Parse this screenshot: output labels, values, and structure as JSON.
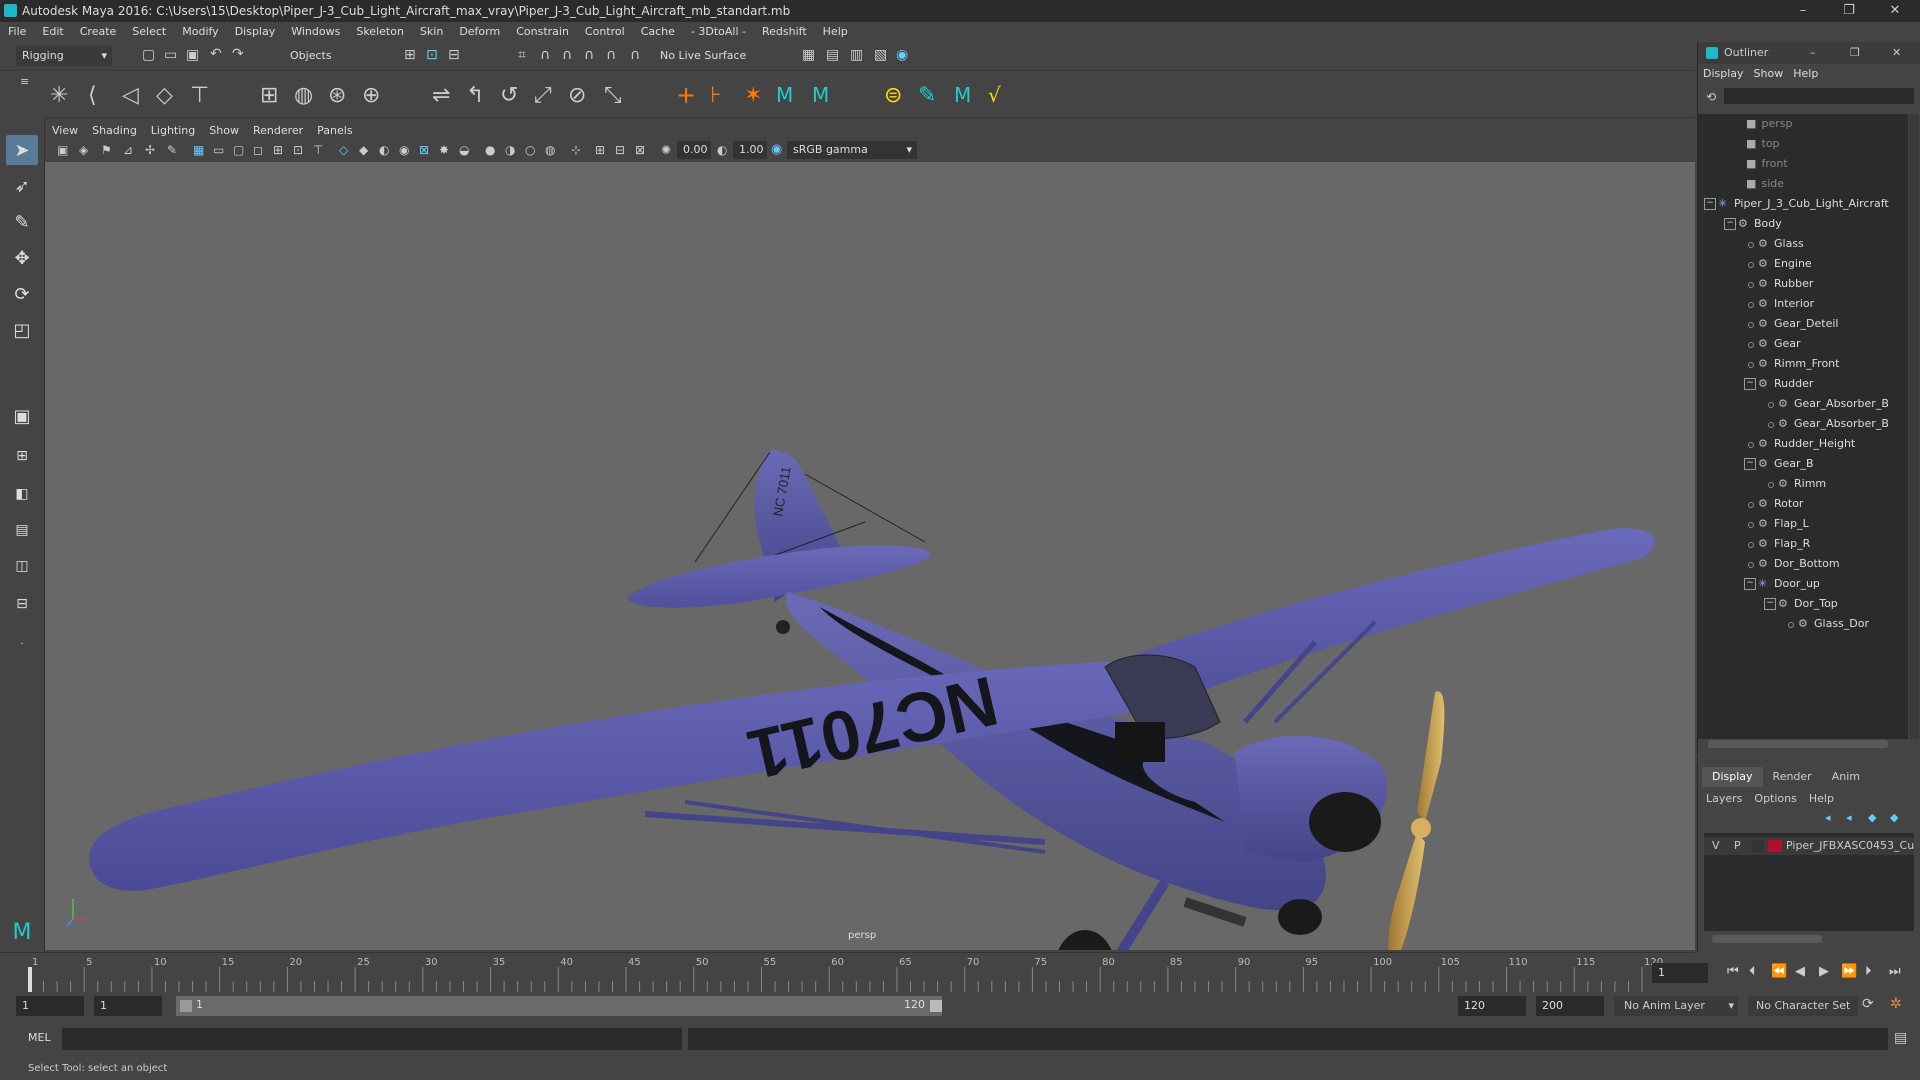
{
  "window": {
    "title": "Autodesk Maya 2016: C:\\Users\\15\\Desktop\\Piper_J-3_Cub_Light_Aircraft_max_vray\\Piper_J-3_Cub_Light_Aircraft_mb_standart.mb",
    "minimize": "–",
    "maximize": "❐",
    "close": "✕"
  },
  "menubar": [
    "File",
    "Edit",
    "Create",
    "Select",
    "Modify",
    "Display",
    "Windows",
    "Skeleton",
    "Skin",
    "Deform",
    "Constrain",
    "Control",
    "Cache",
    "- 3DtoAll -",
    "Redshift",
    "Help"
  ],
  "statusline": {
    "mode": "Rigging",
    "objects_label": "Objects",
    "live_surface": "No Live Surface"
  },
  "viewport": {
    "menus": [
      "View",
      "Shading",
      "Lighting",
      "Show",
      "Renderer",
      "Panels"
    ],
    "field1": "0.00",
    "field2": "1.00",
    "color_space": "sRGB gamma",
    "camera_label": "persp"
  },
  "aircraft": {
    "wing_registration": "NC7011",
    "tail_registration": "NC 7011"
  },
  "outliner": {
    "title": "Outliner",
    "menus": [
      "Display",
      "Show",
      "Help"
    ],
    "cameras": [
      "persp",
      "top",
      "front",
      "side"
    ],
    "items": [
      {
        "label": "Piper_J_3_Cub_Light_Aircraft",
        "depth": 0,
        "expander": "−"
      },
      {
        "label": "Body",
        "depth": 1,
        "expander": "−"
      },
      {
        "label": "Glass",
        "depth": 2,
        "expander": ""
      },
      {
        "label": "Engine",
        "depth": 2,
        "expander": ""
      },
      {
        "label": "Rubber",
        "depth": 2,
        "expander": ""
      },
      {
        "label": "Interior",
        "depth": 2,
        "expander": ""
      },
      {
        "label": "Gear_Deteil",
        "depth": 2,
        "expander": ""
      },
      {
        "label": "Gear",
        "depth": 2,
        "expander": ""
      },
      {
        "label": "Rimm_Front",
        "depth": 2,
        "expander": ""
      },
      {
        "label": "Rudder",
        "depth": 2,
        "expander": "−"
      },
      {
        "label": "Gear_Absorber_B",
        "depth": 3,
        "expander": ""
      },
      {
        "label": "Gear_Absorber_B",
        "depth": 3,
        "expander": ""
      },
      {
        "label": "Rudder_Height",
        "depth": 2,
        "expander": ""
      },
      {
        "label": "Gear_B",
        "depth": 2,
        "expander": "−"
      },
      {
        "label": "Rimm",
        "depth": 3,
        "expander": ""
      },
      {
        "label": "Rotor",
        "depth": 2,
        "expander": ""
      },
      {
        "label": "Flap_L",
        "depth": 2,
        "expander": ""
      },
      {
        "label": "Flap_R",
        "depth": 2,
        "expander": ""
      },
      {
        "label": "Dor_Bottom",
        "depth": 2,
        "expander": ""
      },
      {
        "label": "Door_up",
        "depth": 2,
        "expander": "−"
      },
      {
        "label": "Dor_Top",
        "depth": 3,
        "expander": "−"
      },
      {
        "label": "Glass_Dor",
        "depth": 4,
        "expander": ""
      }
    ]
  },
  "layers": {
    "tabs": [
      "Display",
      "Render",
      "Anim"
    ],
    "menus": [
      "Layers",
      "Options",
      "Help"
    ],
    "row": {
      "v": "V",
      "p": "P",
      "name": "Piper_JFBXASC0453_Cu",
      "color": "#b01030"
    }
  },
  "timeline": {
    "ticks": [
      "1",
      "5",
      "10",
      "15",
      "20",
      "25",
      "30",
      "35",
      "40",
      "45",
      "50",
      "55",
      "60",
      "65",
      "70",
      "75",
      "80",
      "85",
      "90",
      "95",
      "100",
      "105",
      "110",
      "115",
      "120"
    ],
    "current_frame": "1"
  },
  "range": {
    "start": "1",
    "playback_start": "1",
    "slider_start": "1",
    "slider_end": "120",
    "playback_end": "120",
    "end": "200",
    "anim_layer": "No Anim Layer",
    "character_set": "No Character Set"
  },
  "command": {
    "label": "MEL"
  },
  "help": {
    "text": "Select Tool: select an object"
  },
  "colors": {
    "plane": "#5a5aa8",
    "viewport_bg": "#686868",
    "propeller": "#c8a050"
  }
}
